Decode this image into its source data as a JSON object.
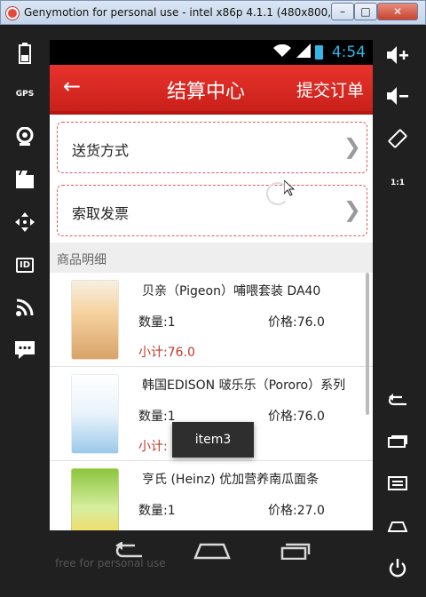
{
  "window": {
    "title": "Genymotion for personal use - intel x86p 4.1.1 (480x800, ...",
    "minimize_label": "–",
    "maximize_label": "□",
    "close_label": "✕"
  },
  "statusbar": {
    "time": "4:54"
  },
  "appbar": {
    "back_icon": "←",
    "title": "结算中心",
    "action": "提交订单"
  },
  "options": [
    {
      "label": "送货方式",
      "chevron": "❯"
    },
    {
      "label": "索取发票",
      "chevron": "❯"
    }
  ],
  "section": {
    "title": "商品明细"
  },
  "products": [
    {
      "name": "贝亲（Pigeon）哺喂套装 DA40",
      "qty": "数量:1",
      "price": "价格:76.0",
      "subtotal": "小计:76.0"
    },
    {
      "name": "韩国EDISON 啵乐乐（Pororo）系列",
      "qty": "数量:1",
      "price": "价格:76.0",
      "subtotal": "小计:"
    },
    {
      "name": "亨氏 (Heinz) 优加营养南瓜面条",
      "qty": "数量:1",
      "price": "价格:27.0",
      "subtotal": ""
    }
  ],
  "toast": "item3",
  "left_sidebar": {
    "gps": "GPS",
    "id": "ID"
  },
  "right_sidebar": {
    "zoom": "1:1"
  },
  "watermark": "free for personal use"
}
